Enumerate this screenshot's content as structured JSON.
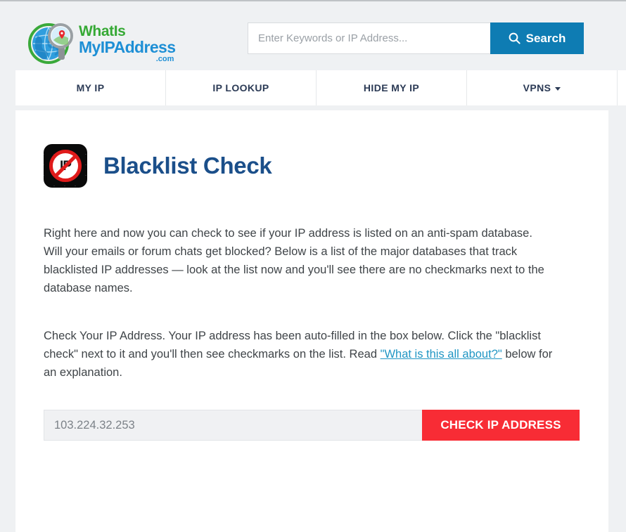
{
  "header": {
    "logo": {
      "line1": "WhatIs",
      "line2": "MyIPAddress",
      "dotcom": ".com",
      "mark_icon": "globe-magnifier-icon"
    },
    "search": {
      "placeholder": "Enter Keywords or IP Address...",
      "value": "",
      "button_label": "Search",
      "button_icon": "search-icon",
      "button_color": "#0e7cb3"
    }
  },
  "nav": {
    "items": [
      {
        "label": "MY IP",
        "has_caret": false
      },
      {
        "label": "IP LOOKUP",
        "has_caret": false
      },
      {
        "label": "HIDE MY IP",
        "has_caret": false
      },
      {
        "label": "VPNS",
        "has_caret": true
      }
    ],
    "partial_item": {
      "label": "·"
    }
  },
  "main": {
    "icon_name": "blacklist-prohibition-icon",
    "icon_letters": "IP",
    "title": "Blacklist Check",
    "title_color": "#1b4f8a",
    "paragraph1": "Right here and now you can check to see if your IP address is listed on an anti-spam database. Will your emails or forum chats get blocked? Below is a list of the major databases that track blacklisted IP addresses — look at the list now and you'll see there are no checkmarks next to the database names.",
    "paragraph2_before": "Check Your IP Address. Your IP address has been auto-filled in the box below. Click the \"blacklist check\" next to it and you'll then see checkmarks on the list. Read ",
    "paragraph2_link": "\"What is this all about?\"",
    "paragraph2_after": " below for an explanation.",
    "link_color": "#2196c4",
    "ip_check": {
      "value": "103.224.32.253",
      "placeholder": "103.224.32.253",
      "button_label": "CHECK IP ADDRESS",
      "button_color": "#f82c35"
    }
  }
}
